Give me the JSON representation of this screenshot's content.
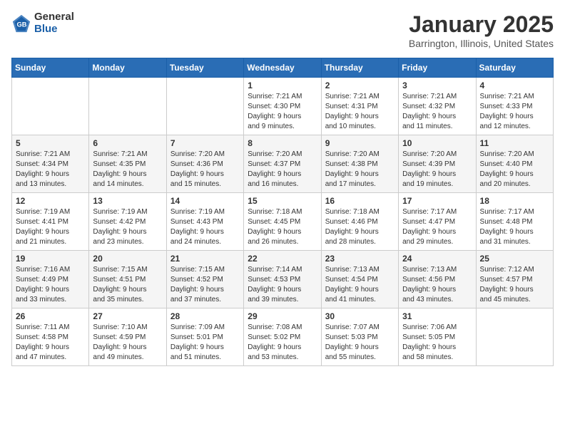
{
  "logo": {
    "general": "General",
    "blue": "Blue"
  },
  "title": "January 2025",
  "location": "Barrington, Illinois, United States",
  "weekdays": [
    "Sunday",
    "Monday",
    "Tuesday",
    "Wednesday",
    "Thursday",
    "Friday",
    "Saturday"
  ],
  "weeks": [
    [
      {
        "day": "",
        "info": ""
      },
      {
        "day": "",
        "info": ""
      },
      {
        "day": "",
        "info": ""
      },
      {
        "day": "1",
        "info": "Sunrise: 7:21 AM\nSunset: 4:30 PM\nDaylight: 9 hours\nand 9 minutes."
      },
      {
        "day": "2",
        "info": "Sunrise: 7:21 AM\nSunset: 4:31 PM\nDaylight: 9 hours\nand 10 minutes."
      },
      {
        "day": "3",
        "info": "Sunrise: 7:21 AM\nSunset: 4:32 PM\nDaylight: 9 hours\nand 11 minutes."
      },
      {
        "day": "4",
        "info": "Sunrise: 7:21 AM\nSunset: 4:33 PM\nDaylight: 9 hours\nand 12 minutes."
      }
    ],
    [
      {
        "day": "5",
        "info": "Sunrise: 7:21 AM\nSunset: 4:34 PM\nDaylight: 9 hours\nand 13 minutes."
      },
      {
        "day": "6",
        "info": "Sunrise: 7:21 AM\nSunset: 4:35 PM\nDaylight: 9 hours\nand 14 minutes."
      },
      {
        "day": "7",
        "info": "Sunrise: 7:20 AM\nSunset: 4:36 PM\nDaylight: 9 hours\nand 15 minutes."
      },
      {
        "day": "8",
        "info": "Sunrise: 7:20 AM\nSunset: 4:37 PM\nDaylight: 9 hours\nand 16 minutes."
      },
      {
        "day": "9",
        "info": "Sunrise: 7:20 AM\nSunset: 4:38 PM\nDaylight: 9 hours\nand 17 minutes."
      },
      {
        "day": "10",
        "info": "Sunrise: 7:20 AM\nSunset: 4:39 PM\nDaylight: 9 hours\nand 19 minutes."
      },
      {
        "day": "11",
        "info": "Sunrise: 7:20 AM\nSunset: 4:40 PM\nDaylight: 9 hours\nand 20 minutes."
      }
    ],
    [
      {
        "day": "12",
        "info": "Sunrise: 7:19 AM\nSunset: 4:41 PM\nDaylight: 9 hours\nand 21 minutes."
      },
      {
        "day": "13",
        "info": "Sunrise: 7:19 AM\nSunset: 4:42 PM\nDaylight: 9 hours\nand 23 minutes."
      },
      {
        "day": "14",
        "info": "Sunrise: 7:19 AM\nSunset: 4:43 PM\nDaylight: 9 hours\nand 24 minutes."
      },
      {
        "day": "15",
        "info": "Sunrise: 7:18 AM\nSunset: 4:45 PM\nDaylight: 9 hours\nand 26 minutes."
      },
      {
        "day": "16",
        "info": "Sunrise: 7:18 AM\nSunset: 4:46 PM\nDaylight: 9 hours\nand 28 minutes."
      },
      {
        "day": "17",
        "info": "Sunrise: 7:17 AM\nSunset: 4:47 PM\nDaylight: 9 hours\nand 29 minutes."
      },
      {
        "day": "18",
        "info": "Sunrise: 7:17 AM\nSunset: 4:48 PM\nDaylight: 9 hours\nand 31 minutes."
      }
    ],
    [
      {
        "day": "19",
        "info": "Sunrise: 7:16 AM\nSunset: 4:49 PM\nDaylight: 9 hours\nand 33 minutes."
      },
      {
        "day": "20",
        "info": "Sunrise: 7:15 AM\nSunset: 4:51 PM\nDaylight: 9 hours\nand 35 minutes."
      },
      {
        "day": "21",
        "info": "Sunrise: 7:15 AM\nSunset: 4:52 PM\nDaylight: 9 hours\nand 37 minutes."
      },
      {
        "day": "22",
        "info": "Sunrise: 7:14 AM\nSunset: 4:53 PM\nDaylight: 9 hours\nand 39 minutes."
      },
      {
        "day": "23",
        "info": "Sunrise: 7:13 AM\nSunset: 4:54 PM\nDaylight: 9 hours\nand 41 minutes."
      },
      {
        "day": "24",
        "info": "Sunrise: 7:13 AM\nSunset: 4:56 PM\nDaylight: 9 hours\nand 43 minutes."
      },
      {
        "day": "25",
        "info": "Sunrise: 7:12 AM\nSunset: 4:57 PM\nDaylight: 9 hours\nand 45 minutes."
      }
    ],
    [
      {
        "day": "26",
        "info": "Sunrise: 7:11 AM\nSunset: 4:58 PM\nDaylight: 9 hours\nand 47 minutes."
      },
      {
        "day": "27",
        "info": "Sunrise: 7:10 AM\nSunset: 4:59 PM\nDaylight: 9 hours\nand 49 minutes."
      },
      {
        "day": "28",
        "info": "Sunrise: 7:09 AM\nSunset: 5:01 PM\nDaylight: 9 hours\nand 51 minutes."
      },
      {
        "day": "29",
        "info": "Sunrise: 7:08 AM\nSunset: 5:02 PM\nDaylight: 9 hours\nand 53 minutes."
      },
      {
        "day": "30",
        "info": "Sunrise: 7:07 AM\nSunset: 5:03 PM\nDaylight: 9 hours\nand 55 minutes."
      },
      {
        "day": "31",
        "info": "Sunrise: 7:06 AM\nSunset: 5:05 PM\nDaylight: 9 hours\nand 58 minutes."
      },
      {
        "day": "",
        "info": ""
      }
    ]
  ]
}
